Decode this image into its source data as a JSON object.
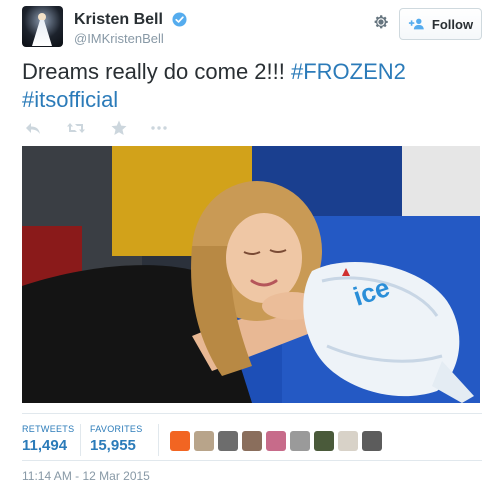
{
  "author": {
    "name": "Kristen Bell",
    "handle": "@IMKristenBell",
    "verified": true,
    "avatar_icon": "avatar-image"
  },
  "header": {
    "settings_icon": "gear-icon",
    "follow_label": "Follow",
    "follow_icon": "add-user-icon"
  },
  "tweet": {
    "text": "Dreams really do come 2!!! ",
    "hashtag1": "#FROZEN2",
    "hashtag2": "#itsofficial"
  },
  "actions": [
    {
      "icon": "reply-icon"
    },
    {
      "icon": "retweet-icon"
    },
    {
      "icon": "favorite-star-icon"
    },
    {
      "icon": "more-icon"
    }
  ],
  "media": {
    "package_text": "ice"
  },
  "stats": {
    "retweets_label": "RETWEETS",
    "retweets_value": "11,494",
    "favorites_label": "FAVORITES",
    "favorites_value": "15,955"
  },
  "favoriters": [
    {
      "color": "#f26522"
    },
    {
      "color": "#b8a48a"
    },
    {
      "color": "#6d6d6d"
    },
    {
      "color": "#8a6e5c"
    },
    {
      "color": "#c76b8a"
    },
    {
      "color": "#9a9a9a"
    },
    {
      "color": "#4a5a3a"
    },
    {
      "color": "#d8d2c8"
    },
    {
      "color": "#5c5c5c"
    }
  ],
  "timestamp": "11:14 AM - 12 Mar 2015",
  "colors": {
    "link": "#2b7bb9",
    "muted": "#8899a6",
    "text": "#292f33"
  }
}
